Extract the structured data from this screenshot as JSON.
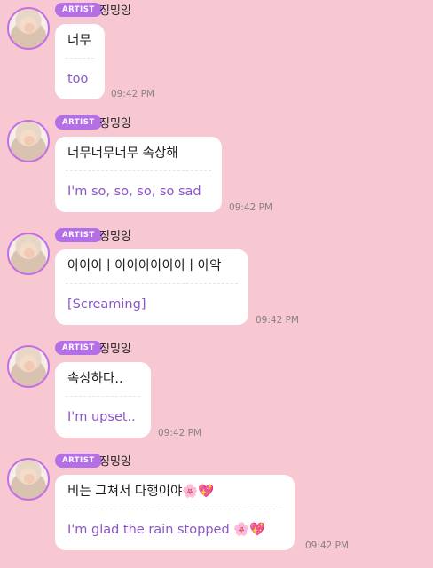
{
  "messages": [
    {
      "badge": "ARTIST",
      "name": "징밍잉",
      "original": "너무",
      "translation": "too",
      "time": "09:42 PM"
    },
    {
      "badge": "ARTIST",
      "name": "징밍잉",
      "original": "너무너무너무 속상해",
      "translation": "I'm so, so, so, so sad",
      "time": "09:42 PM"
    },
    {
      "badge": "ARTIST",
      "name": "징밍잉",
      "original": "아아아ㅏ아아아아아아ㅏ아악",
      "translation": "[Screaming]",
      "time": "09:42 PM"
    },
    {
      "badge": "ARTIST",
      "name": "징밍잉",
      "original": "속상하다..",
      "translation": "I'm upset..",
      "time": "09:42 PM"
    },
    {
      "badge": "ARTIST",
      "name": "징밍잉",
      "original": "비는 그쳐서 다행이야🌸💖",
      "translation": "I'm glad the rain stopped 🌸💖",
      "time": "09:42 PM"
    }
  ],
  "colors": {
    "background": "#f7c8d2",
    "badge": "#b46ee6",
    "translation_text": "#8b56c7",
    "avatar_ring": "#c56ee6"
  },
  "icons": {
    "avatar": "profile-photo"
  }
}
